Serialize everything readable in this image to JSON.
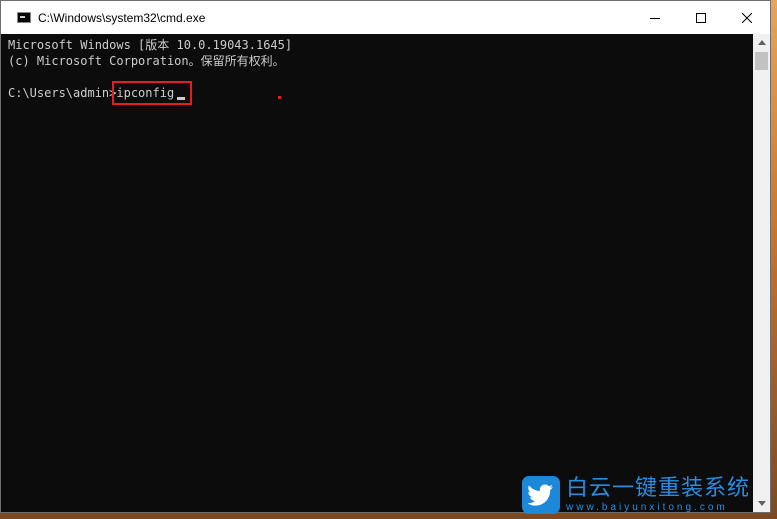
{
  "window": {
    "title": "C:\\Windows\\system32\\cmd.exe",
    "app_icon": "cmd-icon",
    "controls": {
      "minimize_icon": "minimize-icon",
      "maximize_icon": "maximize-icon",
      "close_icon": "close-icon"
    }
  },
  "console": {
    "lines": [
      "Microsoft Windows [版本 10.0.19043.1645]",
      "(c) Microsoft Corporation。保留所有权利。",
      ""
    ],
    "prompt": "C:\\Users\\admin>",
    "command": "ipconfig",
    "highlight_color": "#e02020",
    "text_color": "#cccccc",
    "background_color": "#0c0c0c"
  },
  "watermark": {
    "title": "白云一键重装系统",
    "url": "www.baiyunxitong.com",
    "icon": "bird-icon",
    "color": "#2a8be0"
  }
}
